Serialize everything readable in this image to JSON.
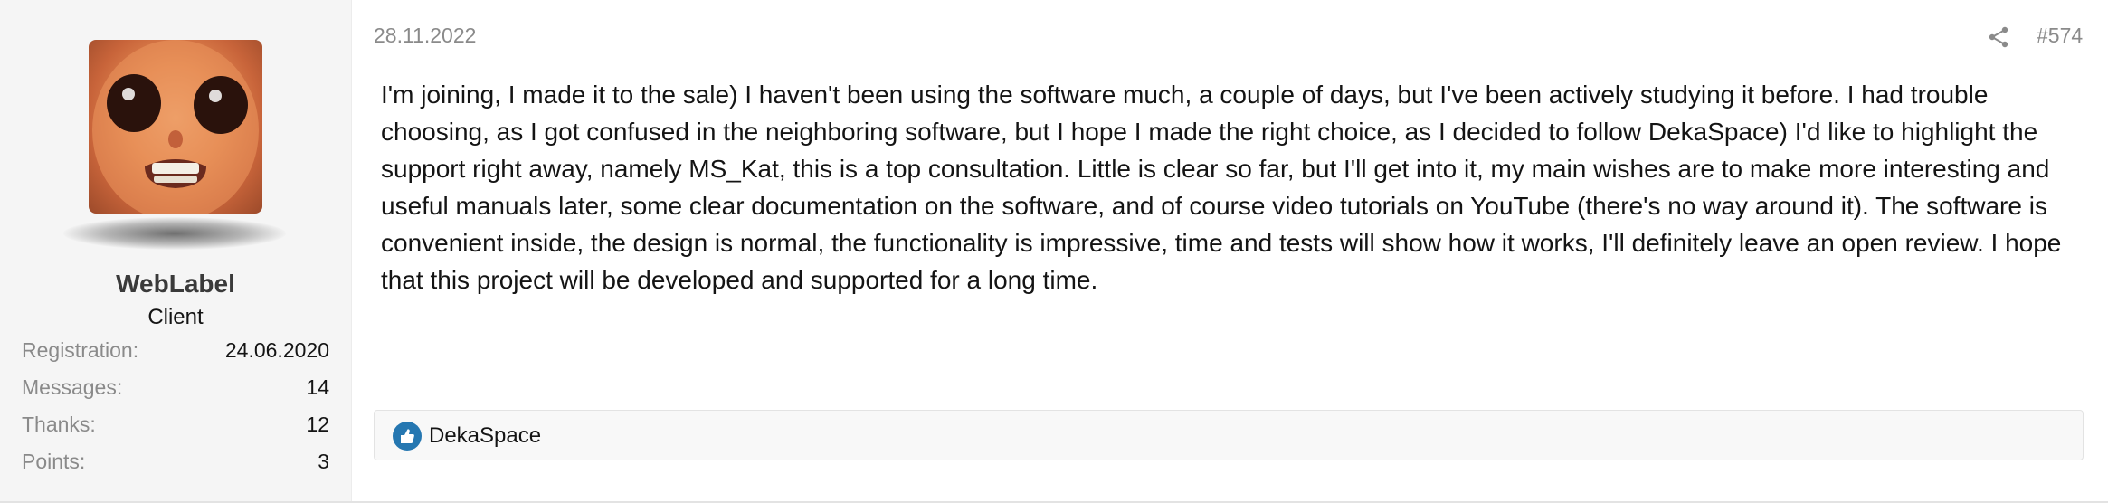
{
  "post": {
    "date": "28.11.2022",
    "number": "#574",
    "body": "I'm joining, I made it to the sale) I haven't been using the software much, a couple of days, but I've been actively studying it before. I had trouble choosing, as I got confused in the neighboring software, but I hope I made the right choice, as I decided to follow DekaSpace) I'd like to highlight the support right away, namely MS_Kat, this is a top consultation. Little is clear so far, but I'll get into it, my main wishes are to make more interesting and useful manuals later, some clear documentation on the software, and of course video tutorials on YouTube (there's no way around it). The software is convenient inside, the design is normal, the functionality is impressive, time and tests will show how it works, I'll definitely leave an open review. I hope that this project will be developed and supported for a long time."
  },
  "user": {
    "name": "WebLabel",
    "title": "Client",
    "stats": [
      {
        "label": "Registration:",
        "value": "24.06.2020"
      },
      {
        "label": "Messages:",
        "value": "14"
      },
      {
        "label": "Thanks:",
        "value": "12"
      },
      {
        "label": "Points:",
        "value": "3"
      }
    ]
  },
  "reactions": {
    "icon": "like-icon",
    "users": [
      "DekaSpace"
    ]
  },
  "icons": {
    "share": "share-icon",
    "like": "thumbs-up-icon"
  },
  "colors": {
    "muted_text": "#8a8a8a",
    "user_column_bg": "#f5f5f5",
    "like_blue": "#2577b1"
  }
}
